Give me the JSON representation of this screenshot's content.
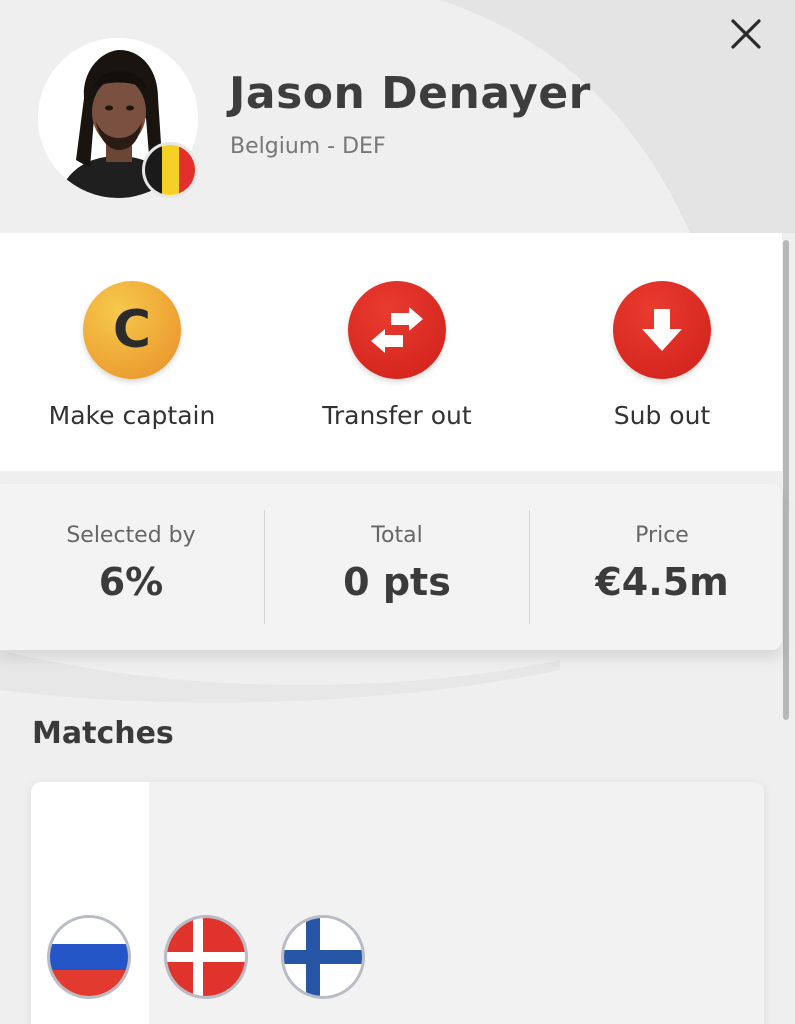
{
  "player": {
    "name": "Jason Denayer",
    "subtitle": "Belgium - DEF",
    "country_flag": "belgium-flag",
    "photo": "player-photo"
  },
  "header": {
    "close_icon": "close-icon"
  },
  "actions": [
    {
      "label": "Make captain",
      "icon": "captain-c-icon",
      "icon_text": "C",
      "color": "#f0a83a"
    },
    {
      "label": "Transfer out",
      "icon": "transfer-arrows-icon",
      "color": "#d9291f"
    },
    {
      "label": "Sub out",
      "icon": "down-arrow-icon",
      "color": "#d9291f"
    }
  ],
  "stats": [
    {
      "label": "Selected by",
      "value": "6%"
    },
    {
      "label": "Total",
      "value": "0 pts"
    },
    {
      "label": "Price",
      "value": "€4.5m"
    }
  ],
  "matches": {
    "title": "Matches",
    "opponents": [
      {
        "icon": "russia-flag-icon"
      },
      {
        "icon": "denmark-flag-icon"
      },
      {
        "icon": "finland-flag-icon"
      }
    ]
  },
  "colors": {
    "gold": "#f0a83a",
    "red": "#d9291f",
    "background": "#efefef",
    "text": "#333333"
  }
}
